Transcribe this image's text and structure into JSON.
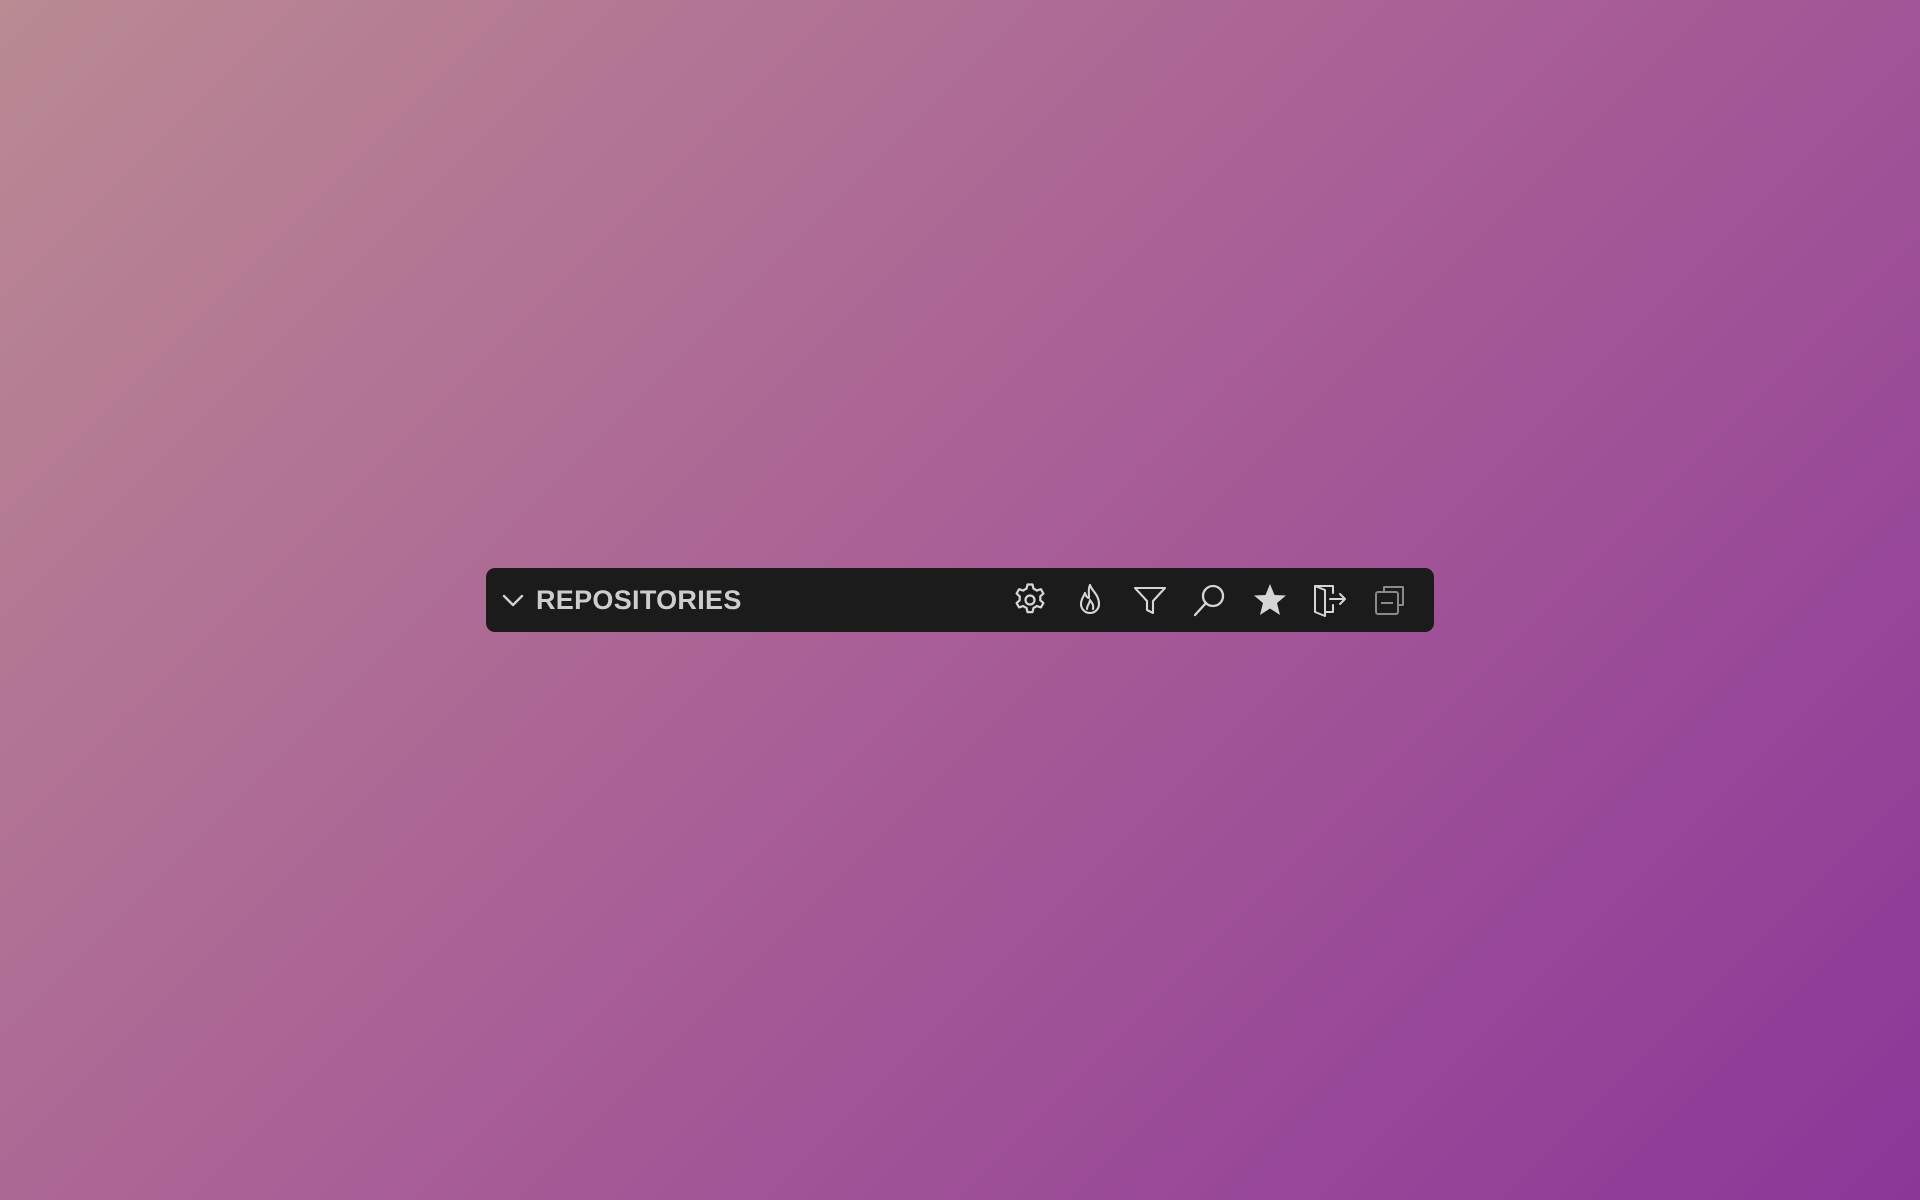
{
  "panel": {
    "title": "REPOSITORIES",
    "toggle_icon": "chevron-down-icon",
    "actions": [
      {
        "name": "settings",
        "icon": "gear-icon"
      },
      {
        "name": "hot",
        "icon": "flame-icon"
      },
      {
        "name": "filter",
        "icon": "filter-icon"
      },
      {
        "name": "search",
        "icon": "search-icon"
      },
      {
        "name": "starred",
        "icon": "star-icon"
      },
      {
        "name": "sign-out",
        "icon": "sign-out-icon"
      },
      {
        "name": "collapse-all",
        "icon": "collapse-all-icon"
      }
    ]
  },
  "colors": {
    "bar_background": "#1b1b1b",
    "text": "#cdcdcd",
    "icon": "#d6d6d6",
    "icon_dim": "#8a8a8a",
    "background_start": "#bb8a93",
    "background_end": "#8c3699"
  }
}
